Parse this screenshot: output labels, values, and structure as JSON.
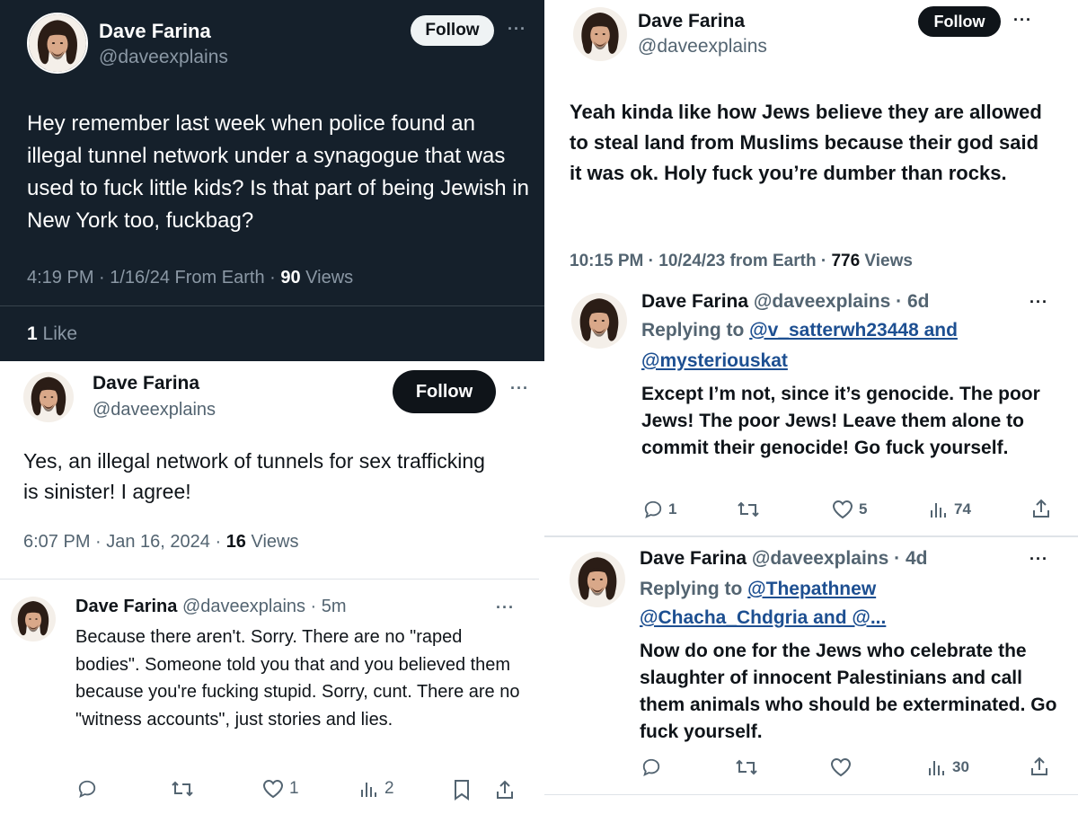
{
  "panel_top_left": {
    "name": "Dave Farina",
    "handle": "@daveexplains",
    "follow_label": "Follow",
    "more": "···",
    "text": "Hey remember last week when police found an illegal tunnel network under a synagogue that was used to fuck little kids? Is that part of being Jewish in New York too, fuckbag?",
    "meta_time": "4:19 PM · 1/16/24 From Earth · ",
    "views_count": "90",
    "views_label": " Views",
    "likes_count": "1",
    "likes_label": " Like"
  },
  "panel_bottom_left": {
    "name": "Dave Farina",
    "handle": "@daveexplains",
    "follow_label": "Follow",
    "more": "···",
    "text": "Yes, an illegal network of tunnels for sex trafficking is sinister! I agree!",
    "meta_time": "6:07 PM · Jan 16, 2024 · ",
    "views_count": "16",
    "views_label": " Views",
    "reply": {
      "name": "Dave Farina",
      "handle_time": "@daveexplains · 5m",
      "more": "···",
      "text": "Because there aren't. Sorry. There are no \"raped bodies\". Someone told you that and you believed them because you're fucking stupid. Sorry, cunt. There are no \"witness accounts\", just stories and lies.",
      "likes": "1",
      "views": "2"
    }
  },
  "panel_right_top": {
    "name": "Dave Farina",
    "handle": "@daveexplains",
    "follow_label": "Follow",
    "more": "···",
    "text": "Yeah kinda like how Jews believe they are allowed to steal land from Muslims because their god said it was ok. Holy fuck you’re dumber than rocks.",
    "meta_time": "10:15 PM · 10/24/23 from Earth · ",
    "views_count": "776",
    "views_label": " Views"
  },
  "panel_right_mid": {
    "name": "Dave Farina",
    "handle_time": "@daveexplains · 6d",
    "more": "···",
    "replying_prefix": "Replying to ",
    "replying_link1": "@v_satterwh23448 and",
    "replying_link2": "@mysteriouskat",
    "text": "Except I’m not, since it’s genocide. The poor Jews! The poor Jews! Leave them alone to commit their genocide! Go fuck yourself.",
    "replies": "1",
    "likes": "5",
    "views": "74"
  },
  "panel_right_bottom": {
    "name": "Dave Farina",
    "handle_time": "@daveexplains · 4d",
    "more": "···",
    "replying_prefix": "Replying to ",
    "replying_link1": "@Thepathnew",
    "replying_link2": "@Chacha_Chdgria and @...",
    "text": "Now do one for the Jews who celebrate the slaughter of innocent Palestinians and call them animals who should be exterminated. Go fuck yourself.",
    "views": "30"
  },
  "colors": {
    "dark_bg": "#15202b",
    "follow_light_bg": "#eff3f4",
    "follow_dark_bg": "#0f1419",
    "link": "#1d4f91",
    "muted": "#536471",
    "muted_dark": "#8b98a5"
  }
}
